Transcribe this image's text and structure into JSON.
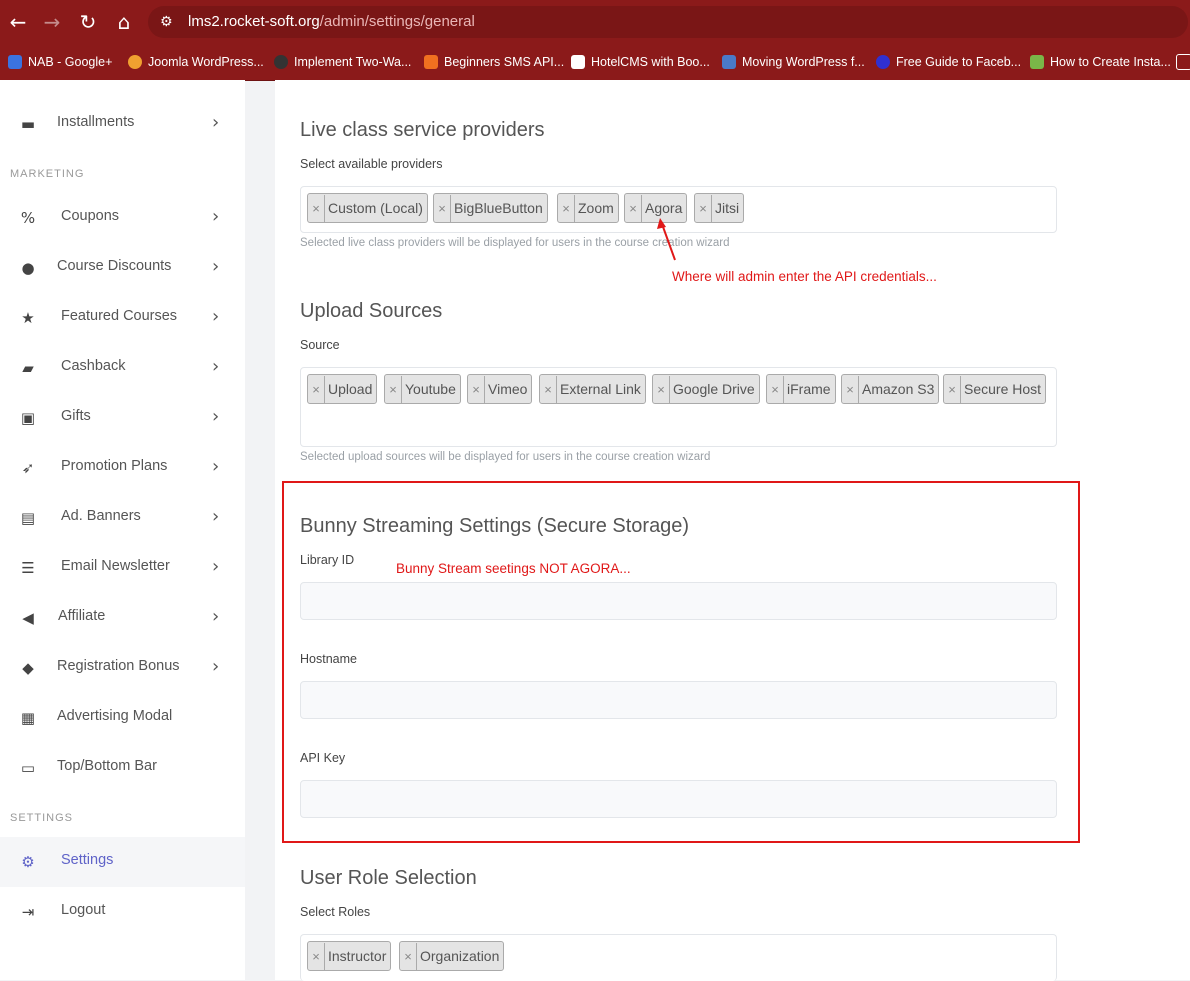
{
  "browser": {
    "url_host": "lms2.rocket-soft.org",
    "url_path": "/admin/settings/general",
    "bookmarks": [
      {
        "label": "NAB - Google+",
        "color": "#3b73e0"
      },
      {
        "label": "Joomla WordPress...",
        "color": "#f0a030"
      },
      {
        "label": "Implement Two-Wa...",
        "color": "#333333"
      },
      {
        "label": "Beginners SMS API...",
        "color": "#f07020"
      },
      {
        "label": "HotelCMS with Boo...",
        "color": "#ffffff"
      },
      {
        "label": "Moving WordPress f...",
        "color": "#4a7ac8"
      },
      {
        "label": "Free Guide to Faceb...",
        "color": "#3030d0"
      },
      {
        "label": "How to Create Insta...",
        "color": "#7ab648"
      }
    ]
  },
  "sidebar": {
    "items": [
      {
        "label": "Installments",
        "icon": "money-icon"
      },
      {
        "label": "Coupons",
        "icon": "percent-icon"
      },
      {
        "label": "Course Discounts",
        "icon": "fire-icon"
      },
      {
        "label": "Featured Courses",
        "icon": "star-icon"
      },
      {
        "label": "Cashback",
        "icon": "wallet-icon"
      },
      {
        "label": "Gifts",
        "icon": "gift-icon"
      },
      {
        "label": "Promotion Plans",
        "icon": "rocket-icon"
      },
      {
        "label": "Ad. Banners",
        "icon": "file-image-icon"
      },
      {
        "label": "Email Newsletter",
        "icon": "newspaper-icon"
      },
      {
        "label": "Affiliate",
        "icon": "megaphone-icon"
      },
      {
        "label": "Registration Bonus",
        "icon": "diamond-icon"
      },
      {
        "label": "Advertising Modal",
        "icon": "ad-icon"
      },
      {
        "label": "Top/Bottom Bar",
        "icon": "window-bar-icon"
      },
      {
        "label": "Settings",
        "icon": "cogs-icon"
      },
      {
        "label": "Logout",
        "icon": "logout-icon"
      }
    ],
    "sections": {
      "marketing": "MARKETING",
      "settings": "SETTINGS"
    },
    "accent": "#5f63c8"
  },
  "live_class": {
    "title": "Live class service providers",
    "label": "Select available providers",
    "tags": [
      "Custom (Local)",
      "BigBlueButton",
      "Zoom",
      "Agora",
      "Jitsi"
    ],
    "help": "Selected live class providers will be displayed for users in the course creation wizard"
  },
  "upload": {
    "title": "Upload Sources",
    "label": "Source",
    "tags": [
      "Upload",
      "Youtube",
      "Vimeo",
      "External Link",
      "Google Drive",
      "iFrame",
      "Amazon S3",
      "Secure Host"
    ],
    "help": "Selected upload sources will be displayed for users in the course creation wizard"
  },
  "bunny": {
    "title": "Bunny Streaming Settings (Secure Storage)",
    "library_label": "Library ID",
    "hostname_label": "Hostname",
    "apikey_label": "API Key"
  },
  "roles": {
    "title": "User Role Selection",
    "label": "Select Roles",
    "tags": [
      "Instructor",
      "Organization"
    ]
  },
  "annotations": {
    "agora_note": "Where will admin enter the API credentials...",
    "bunny_note": "Bunny Stream seetings NOT AGORA...",
    "color": "#e01818"
  },
  "tag_remove_symbol": "×"
}
